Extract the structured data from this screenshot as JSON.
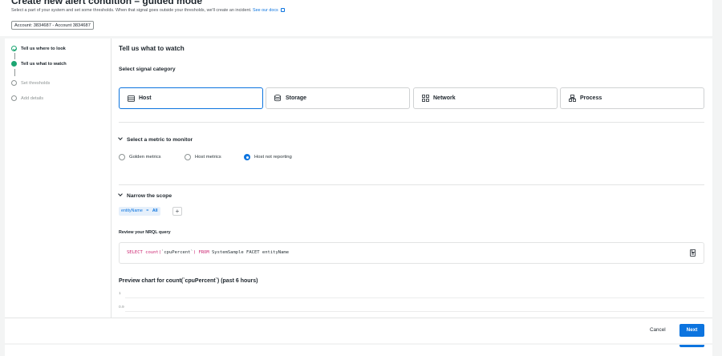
{
  "header": {
    "title": "Create new alert condition – guided mode",
    "subtitle": "Select a part of your system and set some thresholds. When that signal goes outside your thresholds, we'll create an incident.",
    "docs_link": "See our docs",
    "account": "Account: 3834687 - Account 3834687"
  },
  "steps": [
    {
      "label": "Tell us where to look",
      "state": "done"
    },
    {
      "label": "Tell us what to watch",
      "state": "current"
    },
    {
      "label": "Set thresholds",
      "state": "todo"
    },
    {
      "label": "Add details",
      "state": "todo"
    }
  ],
  "main": {
    "section_title": "Tell us what to watch",
    "category_label": "Select signal category",
    "categories": [
      {
        "label": "Host",
        "icon": "host-icon",
        "selected": true
      },
      {
        "label": "Storage",
        "icon": "storage-icon",
        "selected": false
      },
      {
        "label": "Network",
        "icon": "network-icon",
        "selected": false
      },
      {
        "label": "Process",
        "icon": "process-icon",
        "selected": false
      }
    ],
    "metric_section": "Select a metric to monitor",
    "metric_options": [
      {
        "label": "Golden metrics",
        "checked": false
      },
      {
        "label": "Host metrics",
        "checked": false
      },
      {
        "label": "Host not reporting",
        "checked": true
      }
    ],
    "scope_section": "Narrow the scope",
    "scope_filter": {
      "key": "entityName",
      "op": "=",
      "value": "All"
    },
    "add_filter": "+",
    "nrql_label": "Review your NRQL query",
    "nrql": {
      "select_kw": "SELECT",
      "func": "count(",
      "arg": "`cpuPercent`",
      "close": ")",
      "from_kw": "FROM",
      "rest": "SystemSample FACET entityName"
    },
    "chart_title": "Preview chart for count(`cpuPercent`) (past 6 hours)",
    "chart_ticks": [
      "1",
      "0.9"
    ]
  },
  "footer": {
    "cancel": "Cancel",
    "next": "Next"
  },
  "colors": {
    "accent": "#0c74df",
    "success": "#1ca672",
    "nrql_keyword": "#cc2873"
  }
}
